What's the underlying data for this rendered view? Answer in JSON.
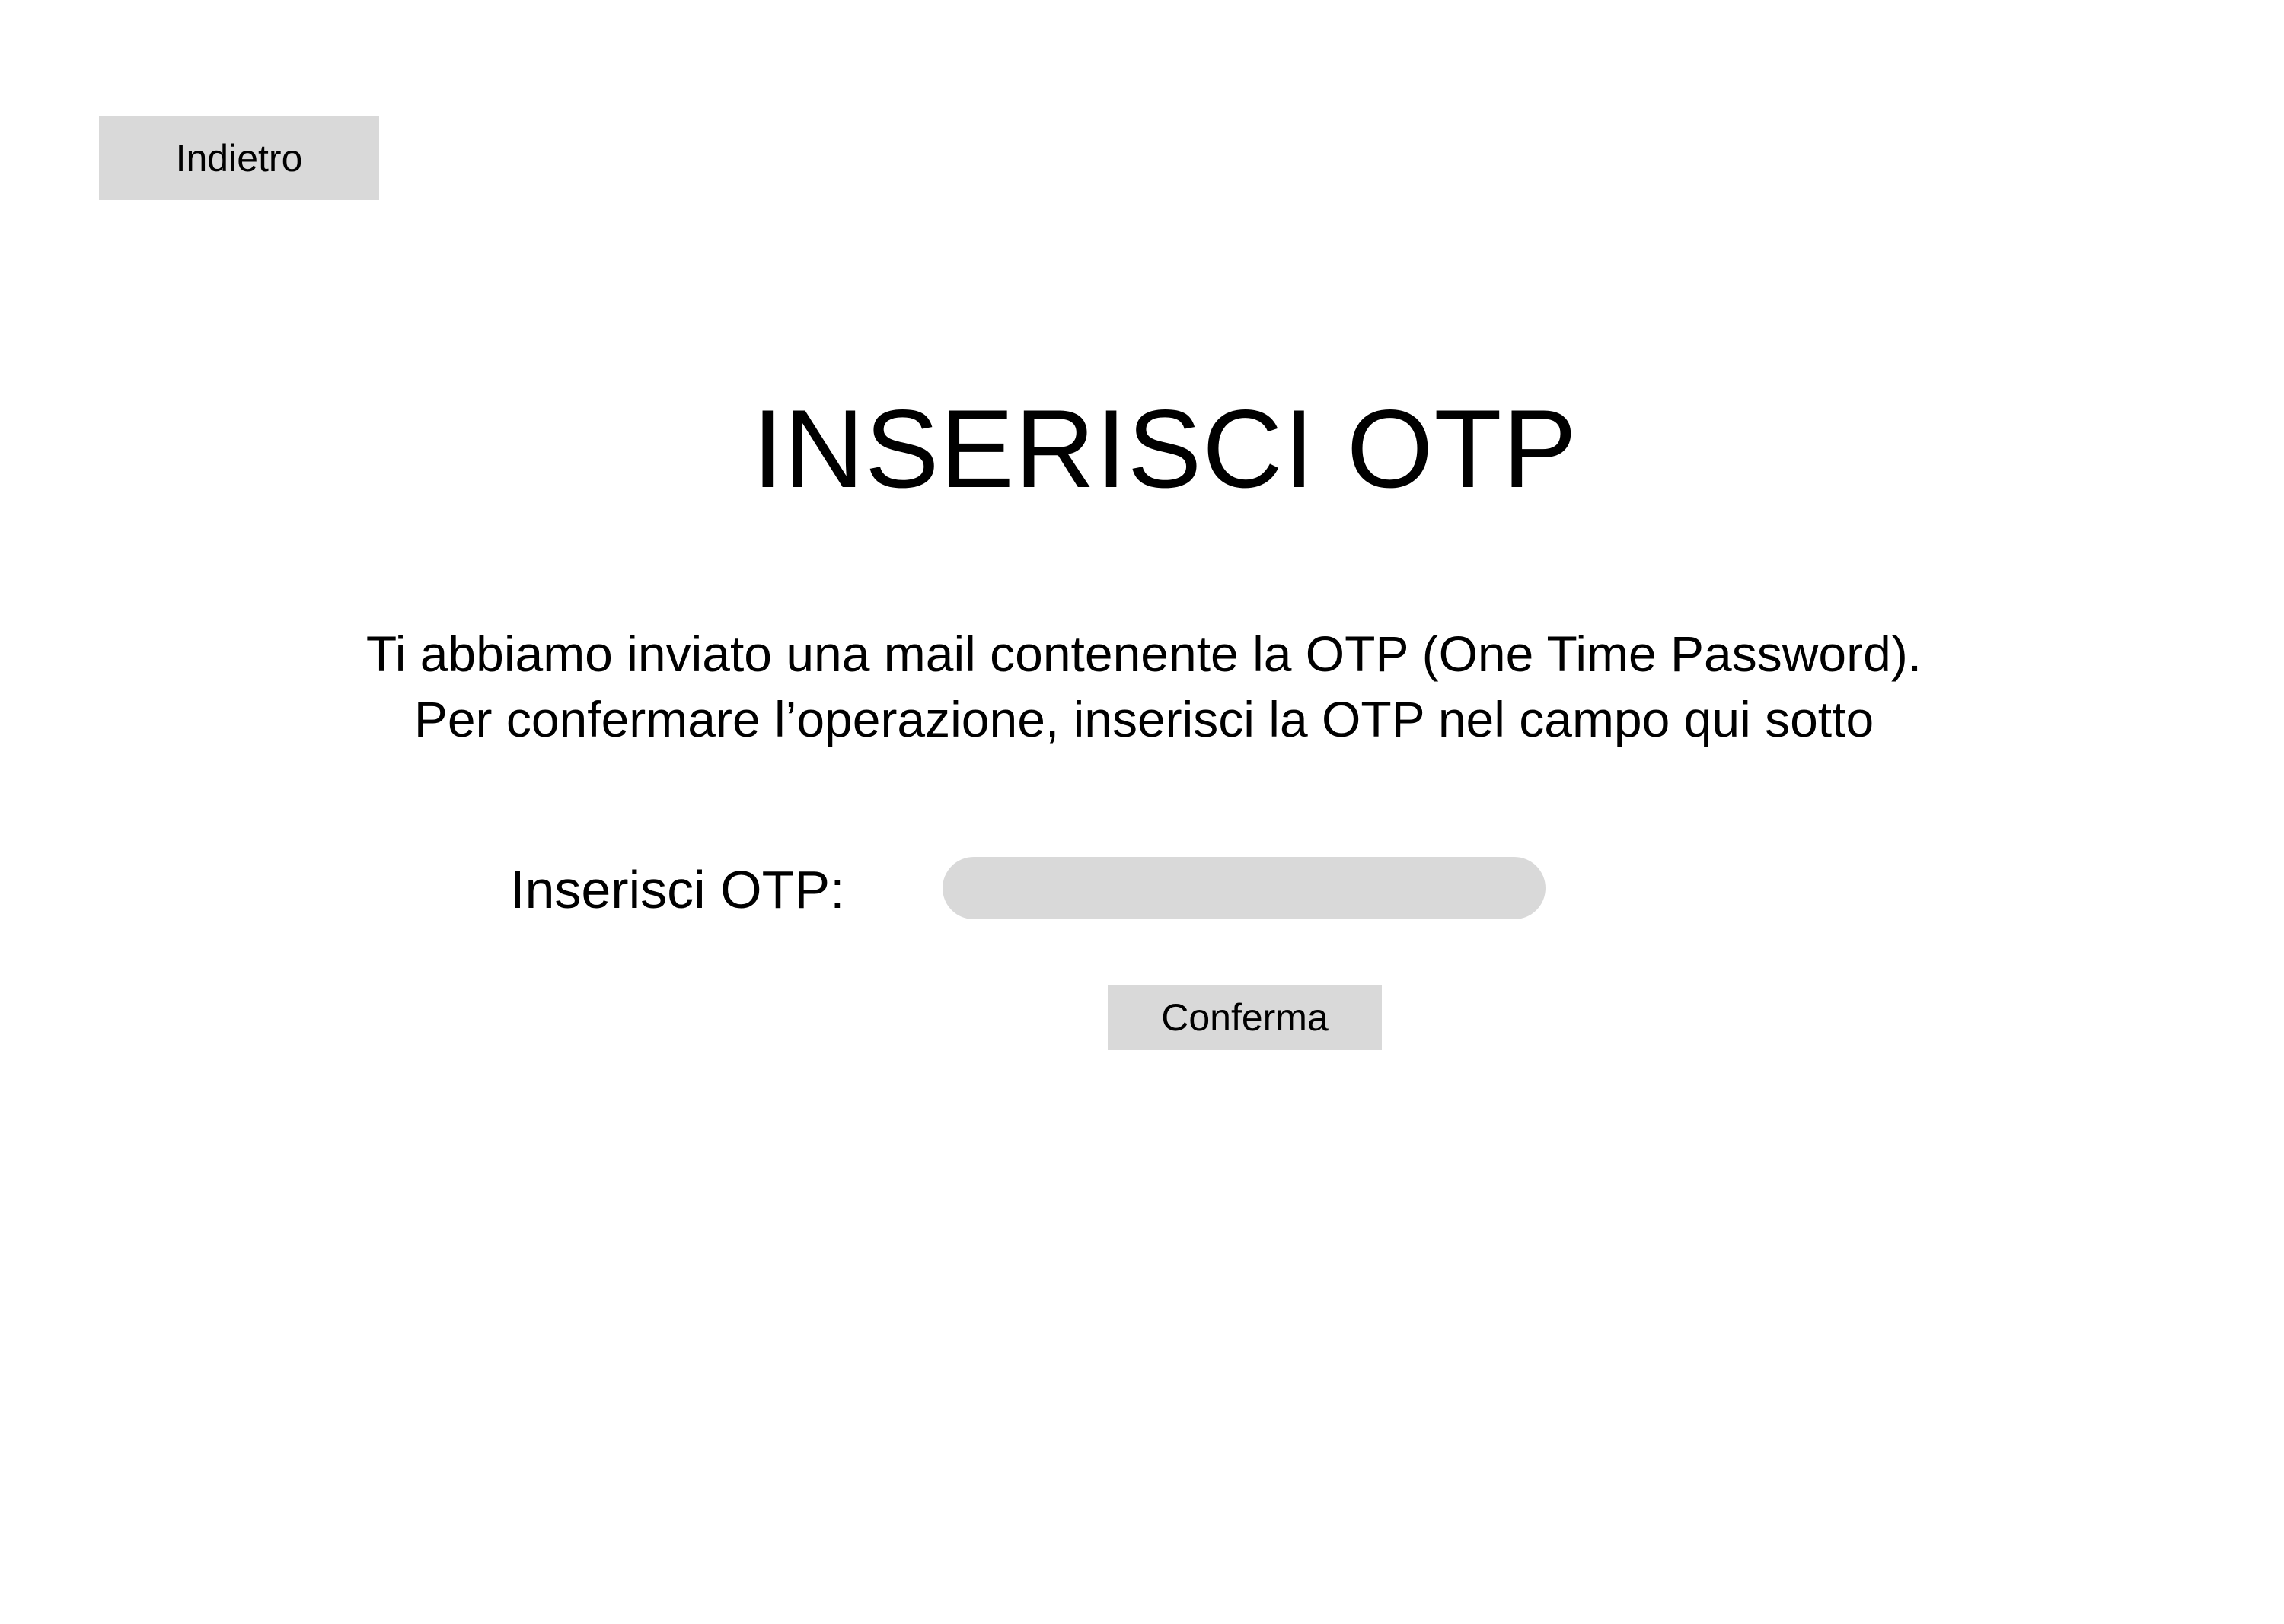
{
  "header": {
    "back_label": "Indietro"
  },
  "main": {
    "title": "INSERISCI OTP",
    "description_line1": "Ti abbiamo inviato una mail contenente la OTP (One Time Password).",
    "description_line2": "Per confermare l’operazione, inserisci la OTP nel campo qui sotto",
    "otp_label": "Inserisci OTP:",
    "otp_value": "",
    "confirm_label": "Conferma"
  },
  "colors": {
    "background": "#ffffff",
    "control_fill": "#d9d9d9",
    "text": "#000000"
  }
}
